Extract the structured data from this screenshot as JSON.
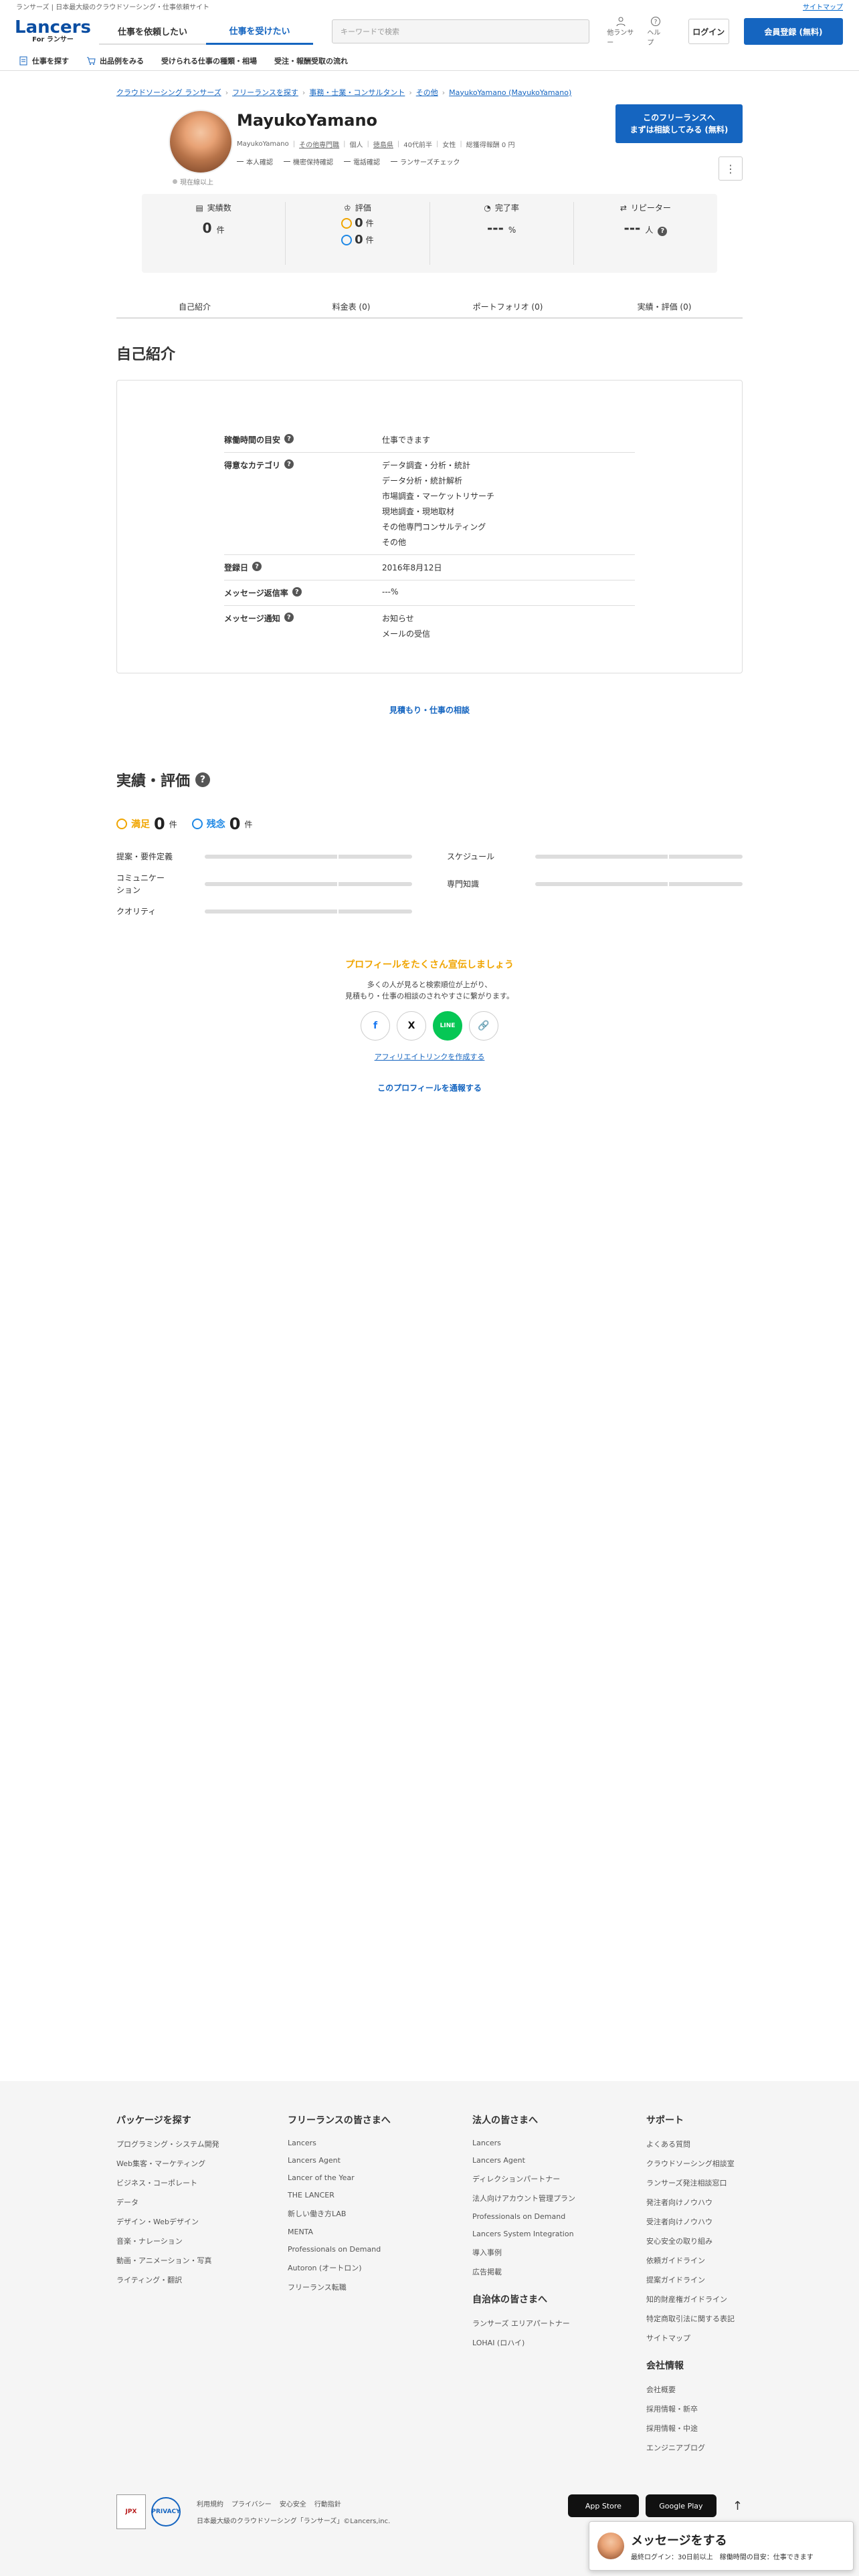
{
  "topbar": {
    "tagline": "ランサーズ | 日本最大級のクラウドソーシング・仕事依頼サイト",
    "sitemap": "サイトマップ"
  },
  "header": {
    "logo_main": "Lancers",
    "logo_sub": "For ランサー",
    "tabs": [
      {
        "label": "仕事を依頼したい"
      },
      {
        "label": "仕事を受けたい"
      }
    ],
    "search_placeholder": "キーワードで検索",
    "icon_for_lancer": "他ランサー",
    "icon_help": "ヘルプ",
    "login": "ログイン",
    "register": "会員登録 (無料)"
  },
  "subnav": [
    {
      "label": "仕事を探す",
      "icon": "doc-icon"
    },
    {
      "label": "出品例をみる",
      "icon": "cart-icon"
    },
    {
      "label": "受けられる仕事の種類・相場",
      "icon": ""
    },
    {
      "label": "受注・報酬受取の流れ",
      "icon": ""
    }
  ],
  "breadcrumb": [
    "クラウドソーシング ランサーズ",
    "フリーランスを探す",
    "事務・士業・コンサルタント",
    "その他",
    "MayukoYamano (MayukoYamano)"
  ],
  "profile": {
    "name": "MayukoYamano",
    "offline": "現在線以上",
    "meta": [
      "MayukoYamano",
      "その他専門職",
      "個人",
      "徳島県",
      "40代前半",
      "女性",
      "総獲得報酬 0 円"
    ],
    "checks": [
      "本人確認",
      "機密保持確認",
      "電話確認",
      "ランサーズチェック"
    ],
    "cta_line1": "このフリーランスへ",
    "cta_line2": "まずは相談してみる (無料)",
    "kebab": "⋮"
  },
  "stats": {
    "works_label": "実績数",
    "works_value": "0",
    "works_unit": "件",
    "eval_label": "評価",
    "eval_good": "0",
    "eval_bad": "0",
    "eval_unit": "件",
    "completion_label": "完了率",
    "completion_value": "---",
    "completion_unit": "%",
    "repeater_label": "リピーター",
    "repeater_value": "---",
    "repeater_unit": "人"
  },
  "profile_tabs": [
    "自己紹介",
    "料金表 (0)",
    "ポートフォリオ (0)",
    "実績・評価 (0)"
  ],
  "intro": {
    "title": "自己紹介",
    "rows": [
      {
        "label": "稼働時間の目安",
        "values": [
          "仕事できます"
        ]
      },
      {
        "label": "得意なカテゴリ",
        "values": [
          "データ調査・分析・統計",
          "データ分析・統計解析",
          "市場調査・マーケットリサーチ",
          "現地調査・現地取材",
          "その他専門コンサルティング",
          "その他"
        ]
      },
      {
        "label": "登録日",
        "values": [
          "2016年8月12日"
        ]
      },
      {
        "label": "メッセージ返信率",
        "values": [
          "---%"
        ]
      },
      {
        "label": "メッセージ通知",
        "values": [
          "お知らせ",
          "メールの受信"
        ]
      }
    ],
    "consult_link": "見積もり・仕事の相談"
  },
  "review": {
    "title": "実績・評価",
    "good_label": "満足",
    "good_count": "0",
    "bad_label": "残念",
    "bad_count": "0",
    "unit": "件",
    "bars": [
      "提案・要件定義",
      "スケジュール",
      "コミュニケーション",
      "専門知識",
      "クオリティ"
    ]
  },
  "share": {
    "title": "プロフィールをたくさん宣伝しましょう",
    "desc1": "多くの人が見ると検索順位が上がり、",
    "desc2": "見積もり・仕事の相談のされやすさに繋がります。",
    "affiliate": "アフィリエイトリンクを作成する",
    "report": "このプロフィールを通報する",
    "x_glyph": "X",
    "line_glyph": "LINE"
  },
  "footer": {
    "cols": [
      {
        "title": "パッケージを探す",
        "links": [
          "プログラミング・システム開発",
          "Web集客・マーケティング",
          "ビジネス・コーポレート",
          "データ",
          "デザイン・Webデザイン",
          "音楽・ナレーション",
          "動画・アニメーション・写真",
          "ライティング・翻訳"
        ]
      },
      {
        "title": "フリーランスの皆さまへ",
        "links": [
          "Lancers",
          "Lancers Agent",
          "Lancer of the Year",
          "THE LANCER",
          "新しい働き方LAB",
          "MENTA",
          "Professionals on Demand",
          "Autoron (オートロン)",
          "フリーランス転職"
        ]
      },
      {
        "title": "法人の皆さまへ",
        "links": [
          "Lancers",
          "Lancers Agent",
          "ディレクションパートナー",
          "法人向けアカウント管理プラン",
          "Professionals on Demand",
          "Lancers System Integration",
          "導入事例",
          "広告掲載"
        ],
        "sub_title": "自治体の皆さまへ",
        "sub_links": [
          "ランサーズ エリアパートナー",
          "LOHAI (ロハイ)"
        ]
      },
      {
        "title": "サポート",
        "links": [
          "よくある質問",
          "クラウドソーシング相談室",
          "ランサーズ発注相談窓口",
          "発注者向けノウハウ",
          "受注者向けノウハウ",
          "安心安全の取り組み",
          "依頼ガイドライン",
          "提案ガイドライン",
          "知的財産権ガイドライン",
          "特定商取引法に関する表記",
          "サイトマップ"
        ],
        "sub_title": "会社情報",
        "sub_links": [
          "会社概要",
          "採用情報・新卒",
          "採用情報・中途",
          "エンジニアブログ"
        ]
      }
    ],
    "badge_jpx": "JPX",
    "badge_p": "PRIVACY",
    "links": [
      "利用規約",
      "プライバシー",
      "安心安全",
      "行動指針"
    ],
    "copyright": "日本最大級のクラウドソーシング「ランサーズ」©Lancers,inc.",
    "app_store": "App Store",
    "google_play": "Google Play",
    "totop": "↑"
  },
  "message_bar": {
    "title": "メッセージをする",
    "status": "最終ログイン：30日前以上　稼働時間の目安：仕事できます"
  },
  "colors": {
    "brand": "#1565c0",
    "good": "#f0a500",
    "bad": "#1e88e5"
  }
}
